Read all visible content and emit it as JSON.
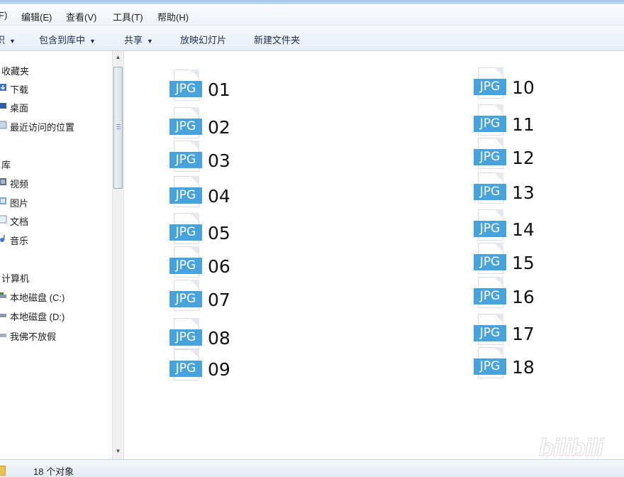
{
  "menubar": {
    "items": [
      "F)",
      "编辑(E)",
      "查看(V)",
      "工具(T)",
      "帮助(H)"
    ]
  },
  "toolbar": {
    "organize": "织",
    "include": "包含到库中",
    "share": "共享",
    "slideshow": "放映幻灯片",
    "new_folder": "新建文件夹"
  },
  "nav": {
    "favorites": "收藏夹",
    "downloads": "下载",
    "desktop": "桌面",
    "recent": "最近访问的位置",
    "libraries": "库",
    "videos": "视频",
    "pictures": "图片",
    "documents": "文档",
    "music": "音乐",
    "computer": "计算机",
    "disk_c": "本地磁盘 (C:)",
    "disk_d": "本地磁盘 (D:)",
    "custom": "我佛不放假"
  },
  "files": {
    "badge": "JPG",
    "names": [
      "01",
      "02",
      "03",
      "04",
      "05",
      "06",
      "07",
      "08",
      "09",
      "10",
      "11",
      "12",
      "13",
      "14",
      "15",
      "16",
      "17",
      "18"
    ]
  },
  "status": {
    "count": "18 个对象"
  },
  "watermark": "bilibili",
  "colors": {
    "jpg_badge": "#48a2dc",
    "toolbar_text": "#1e3050"
  }
}
